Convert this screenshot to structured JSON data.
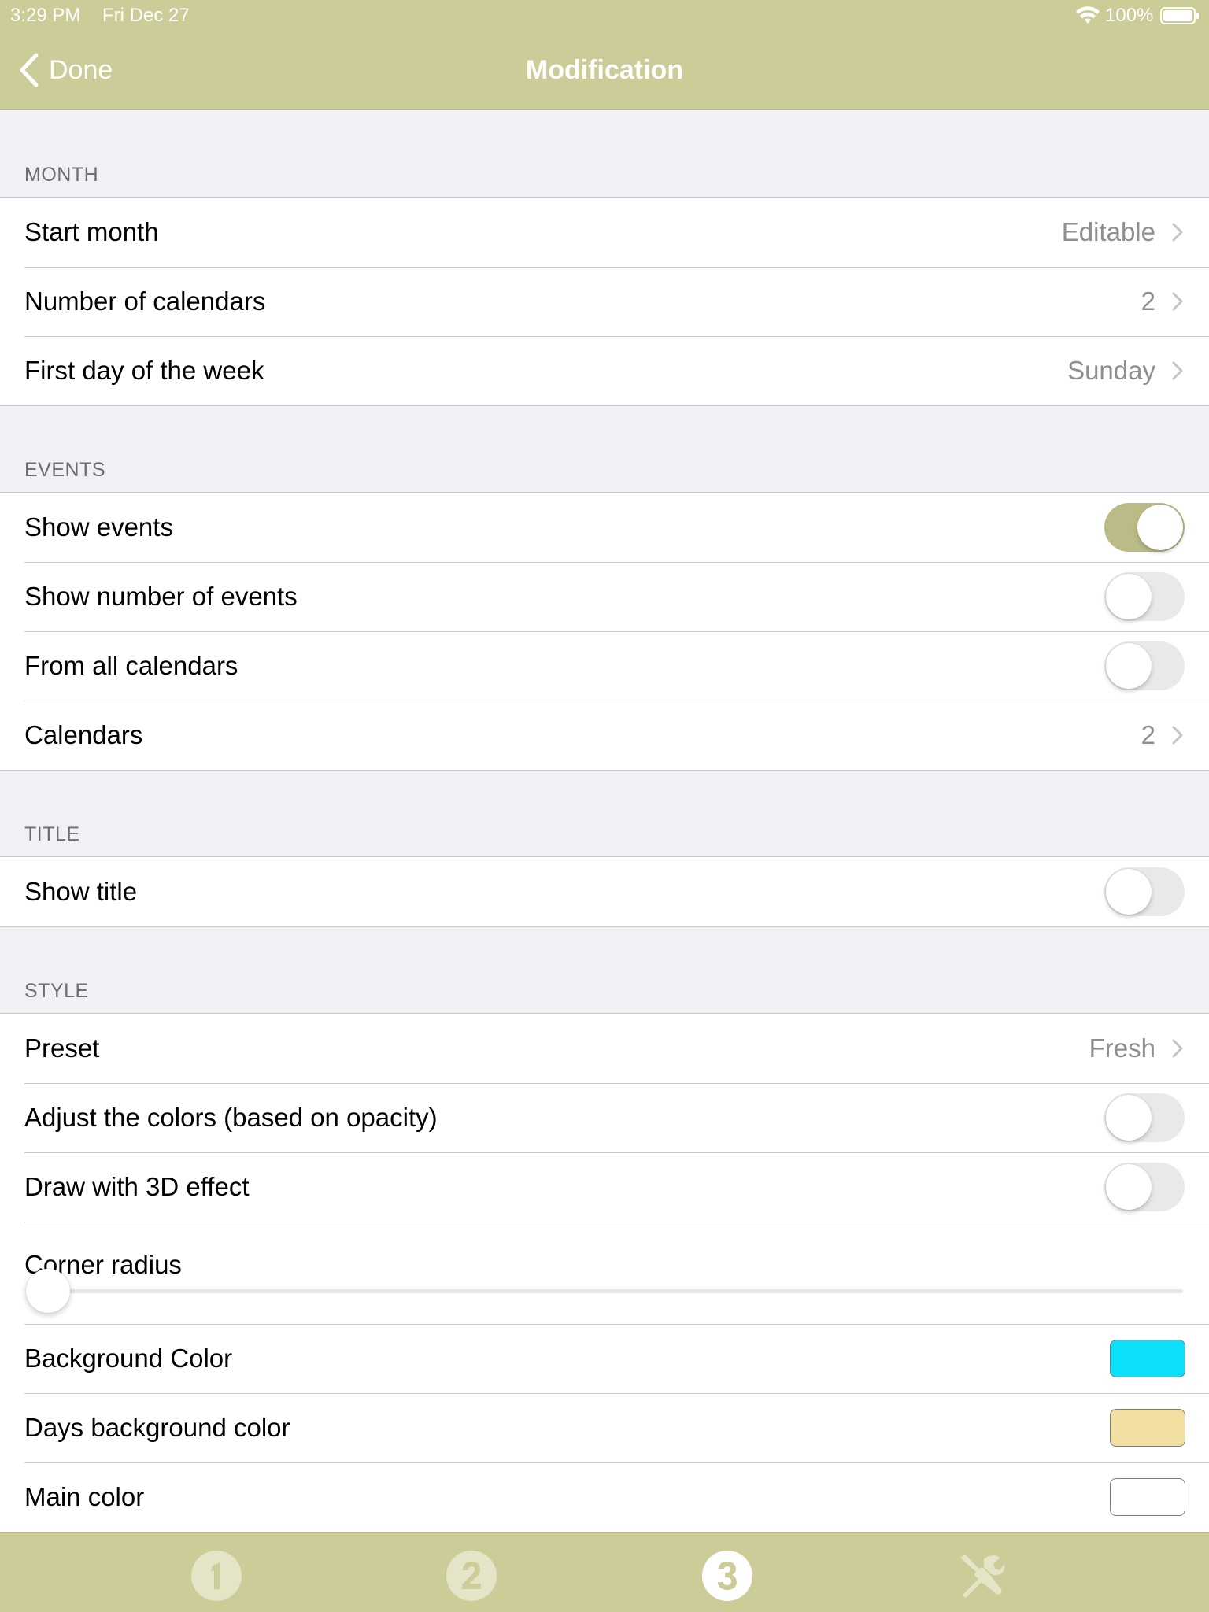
{
  "status_bar": {
    "time": "3:29 PM",
    "date": "Fri Dec 27",
    "battery": "100%"
  },
  "nav": {
    "back_label": "Done",
    "title": "Modification"
  },
  "colors": {
    "accent": "#cccc99",
    "toggle_on": "#bbbb88",
    "background_color": "#0ae0fa",
    "days_background_color": "#f2e0a3",
    "main_color": "#ffffff"
  },
  "sections": {
    "month": {
      "header": "MONTH",
      "rows": [
        {
          "label": "Start month",
          "value": "Editable"
        },
        {
          "label": "Number of calendars",
          "value": "2"
        },
        {
          "label": "First day of the week",
          "value": "Sunday"
        }
      ]
    },
    "events": {
      "header": "EVENTS",
      "rows": [
        {
          "label": "Show events",
          "on": true
        },
        {
          "label": "Show number of events",
          "on": false
        },
        {
          "label": "From all calendars",
          "on": false
        },
        {
          "label": "Calendars",
          "value": "2"
        }
      ]
    },
    "title": {
      "header": "TITLE",
      "rows": [
        {
          "label": "Show title",
          "on": false
        }
      ]
    },
    "style": {
      "header": "STYLE",
      "rows": [
        {
          "label": "Preset",
          "value": "Fresh"
        },
        {
          "label": "Adjust the colors (based on opacity)",
          "on": false
        },
        {
          "label": "Draw with 3D effect",
          "on": false
        },
        {
          "label": "Corner radius",
          "slider_value": 0
        },
        {
          "label": "Background Color"
        },
        {
          "label": "Days background color"
        },
        {
          "label": "Main color"
        }
      ]
    }
  },
  "tabs": [
    {
      "icon": "number-one-icon",
      "active": false
    },
    {
      "icon": "number-two-icon",
      "active": false
    },
    {
      "icon": "number-three-icon",
      "active": true
    },
    {
      "icon": "tools-icon",
      "active": false
    }
  ]
}
